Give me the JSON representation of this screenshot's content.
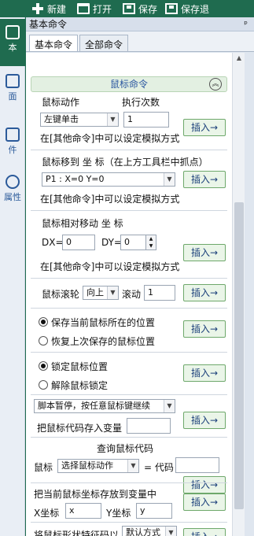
{
  "toolbar": {
    "new_label": "新建",
    "open_label": "打开",
    "save_label": "保存",
    "saveas_label": "保存退"
  },
  "leftbar": {
    "items": [
      "本",
      "面",
      "件",
      "属性"
    ]
  },
  "panel": {
    "title": "基本命令",
    "pin": "ᵖ",
    "tabs": [
      "基本命令",
      "全部命令"
    ]
  },
  "mouse_section": {
    "title": "鼠标命令",
    "collapse_icon": "«"
  },
  "mouse_action": {
    "label_action": "鼠标动作",
    "label_count": "执行次数",
    "action_value": "左键单击",
    "count_value": "1",
    "hint": "在[其他命令]中可以设定模拟方式",
    "insert": "插入→"
  },
  "mouse_move": {
    "label": "鼠标移到   坐 标（在上方工具栏中抓点）",
    "point_value": "P1 : X=0 Y=0",
    "hint": "在[其他命令]中可以设定模拟方式",
    "insert": "插入→"
  },
  "mouse_relative": {
    "label": "鼠标相对移动      坐 标",
    "dx_label": "DX=",
    "dx_value": "0",
    "dy_label": "DY=",
    "dy_value": "0",
    "hint": "在[其他命令]中可以设定模拟方式",
    "insert": "插入→"
  },
  "mouse_wheel": {
    "label": "鼠标滚轮",
    "dir_value": "向上",
    "scroll_label": "滚动",
    "scroll_value": "1",
    "insert": "插入→"
  },
  "save_pos": {
    "option1": "保存当前鼠标所在的位置",
    "option2": "恢复上次保存的鼠标位置",
    "insert": "插入→"
  },
  "lock_pos": {
    "option1": "锁定鼠标位置",
    "option2": "解除鼠标锁定",
    "insert": "插入→"
  },
  "pause": {
    "select_value": "脚本暂停，按任意鼠标键继续",
    "code_label": "把鼠标代码存入变量",
    "insert": "插入→"
  },
  "query": {
    "title": "查询鼠标代码",
    "label": "鼠标",
    "select_value": "选择鼠标动作",
    "eq_label": "= 代码",
    "insert": "插入→"
  },
  "store_coords": {
    "label": "把当前鼠标坐标存放到变量中",
    "x_label": "X坐标",
    "x_value": "x",
    "y_label": "Y坐标",
    "y_value": "y",
    "insert": "插入→"
  },
  "shape": {
    "label": "将鼠标形状特征码以",
    "select_value": "默认方式",
    "insert": "插入→"
  }
}
